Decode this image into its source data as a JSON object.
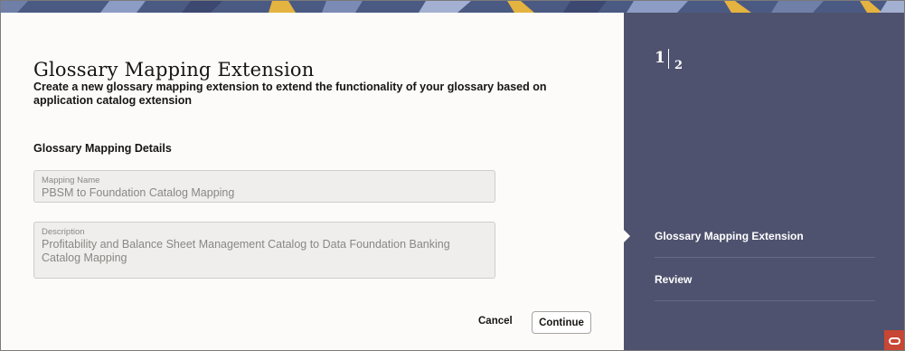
{
  "main": {
    "title": "Glossary Mapping Extension",
    "subtitle": "Create a new glossary mapping extension to extend the functionality of your glossary based on application catalog extension",
    "section_title": "Glossary Mapping Details",
    "fields": {
      "mapping_name": {
        "label": "Mapping Name",
        "value": "PBSM to Foundation Catalog Mapping"
      },
      "description": {
        "label": "Description",
        "value": "Profitability and Balance Sheet Management Catalog to Data Foundation Banking Catalog Mapping"
      }
    },
    "buttons": {
      "cancel": "Cancel",
      "continue": "Continue"
    }
  },
  "side": {
    "step_current": "1",
    "step_total": "2",
    "steps": [
      {
        "label": "Glossary Mapping Extension",
        "active": true
      },
      {
        "label": "Review",
        "active": false
      }
    ]
  },
  "colors": {
    "side_panel": "#4f526e",
    "banner": "#4b5a82",
    "main_bg": "#fcfbfa",
    "oracle_red": "#c74634"
  },
  "icons": {
    "brand": "oracle-logo-icon"
  }
}
